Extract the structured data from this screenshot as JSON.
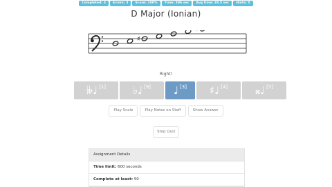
{
  "stats": [
    "Completed: 3",
    "Errors: 3",
    "Score: 100%",
    "Time: 386 sec",
    "Avg time: 28.5 sec",
    "Hints: 0"
  ],
  "title": "D Major (Ionian)",
  "staff": {
    "clef": "bass",
    "notes": [
      {
        "pitch": "D3",
        "accidental": ""
      },
      {
        "pitch": "E3",
        "accidental": ""
      },
      {
        "pitch": "F#3",
        "accidental": "sharp"
      },
      {
        "pitch": "G3",
        "accidental": ""
      },
      {
        "pitch": "A3",
        "accidental": ""
      },
      {
        "pitch": "B3",
        "accidental": ""
      },
      {
        "pitch": "C#4",
        "accidental": "sharp"
      },
      {
        "pitch": "D4",
        "accidental": ""
      }
    ]
  },
  "feedback": "Right!",
  "answers": [
    {
      "glyph": "𝄫♩",
      "number": "[1]",
      "selected": false
    },
    {
      "glyph": "♭♩",
      "number": "[9]",
      "selected": false
    },
    {
      "glyph": "♩",
      "number": "[3]",
      "selected": true
    },
    {
      "glyph": "♯♩",
      "number": "[4]",
      "selected": false
    },
    {
      "glyph": "𝄪♩",
      "number": "[5]",
      "selected": false
    }
  ],
  "buttons": {
    "play_scale": "Play Scale",
    "play_notes": "Play Notes on Staff",
    "show_answer": "Show Answer",
    "stop_quiz": "Stop Quiz"
  },
  "assignment": {
    "header": "Assignment Details",
    "time_limit_label": "Time limit:",
    "time_limit_value": "600 seconds",
    "complete_label": "Complete at least:",
    "complete_value": "50"
  },
  "colors": {
    "stat_badge": "#5bc0de",
    "answer_selected": "#6e9bc5",
    "answer_default": "#d2d2d2"
  }
}
